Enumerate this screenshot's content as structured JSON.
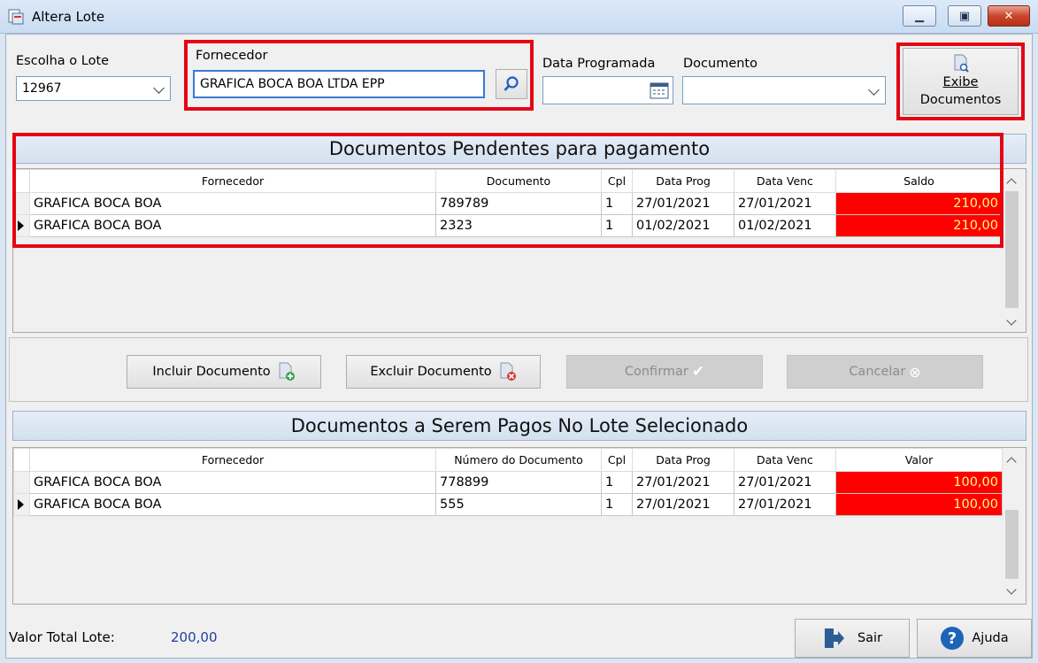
{
  "window": {
    "title": "Altera Lote"
  },
  "lote": {
    "label": "Escolha o Lote",
    "value": "12967"
  },
  "fornecedor": {
    "label": "Fornecedor",
    "value": "GRAFICA BOCA BOA LTDA EPP"
  },
  "data_programada": {
    "label": "Data Programada",
    "value": ""
  },
  "documento": {
    "label": "Documento",
    "value": ""
  },
  "exibe": {
    "label_1": "Exibe",
    "label_2": "Documentos"
  },
  "pendentes": {
    "title": "Documentos Pendentes para pagamento",
    "columns": [
      "Fornecedor",
      "Documento",
      "Cpl",
      "Data Prog",
      "Data Venc",
      "Saldo"
    ],
    "rows": [
      {
        "fornecedor": "GRAFICA BOCA BOA",
        "documento": "789789",
        "cpl": "1",
        "data_prog": "27/01/2021",
        "data_venc": "27/01/2021",
        "saldo": "210,00"
      },
      {
        "fornecedor": "GRAFICA BOCA BOA",
        "documento": "2323",
        "cpl": "1",
        "data_prog": "01/02/2021",
        "data_venc": "01/02/2021",
        "saldo": "210,00"
      }
    ]
  },
  "actions": {
    "incluir": "Incluir Documento",
    "excluir": "Excluir Documento",
    "confirmar": "Confirmar",
    "cancelar": "Cancelar"
  },
  "lote_docs": {
    "title": "Documentos a Serem Pagos No Lote Selecionado",
    "columns": [
      "Fornecedor",
      "Número do Documento",
      "Cpl",
      "Data Prog",
      "Data Venc",
      "Valor"
    ],
    "rows": [
      {
        "fornecedor": "GRAFICA BOCA BOA",
        "documento": "778899",
        "cpl": "1",
        "data_prog": "27/01/2021",
        "data_venc": "27/01/2021",
        "valor": "100,00"
      },
      {
        "fornecedor": "GRAFICA BOCA BOA",
        "documento": "555",
        "cpl": "1",
        "data_prog": "27/01/2021",
        "data_venc": "27/01/2021",
        "valor": "100,00"
      }
    ]
  },
  "footer": {
    "total_label": "Valor Total Lote:",
    "total_value": "200,00",
    "sair": "Sair",
    "ajuda": "Ajuda"
  },
  "colors": {
    "highlight": "#e30613",
    "saldo_bg": "#ff0000",
    "saldo_text": "#ffff80",
    "total_value": "#1f3fa6"
  }
}
